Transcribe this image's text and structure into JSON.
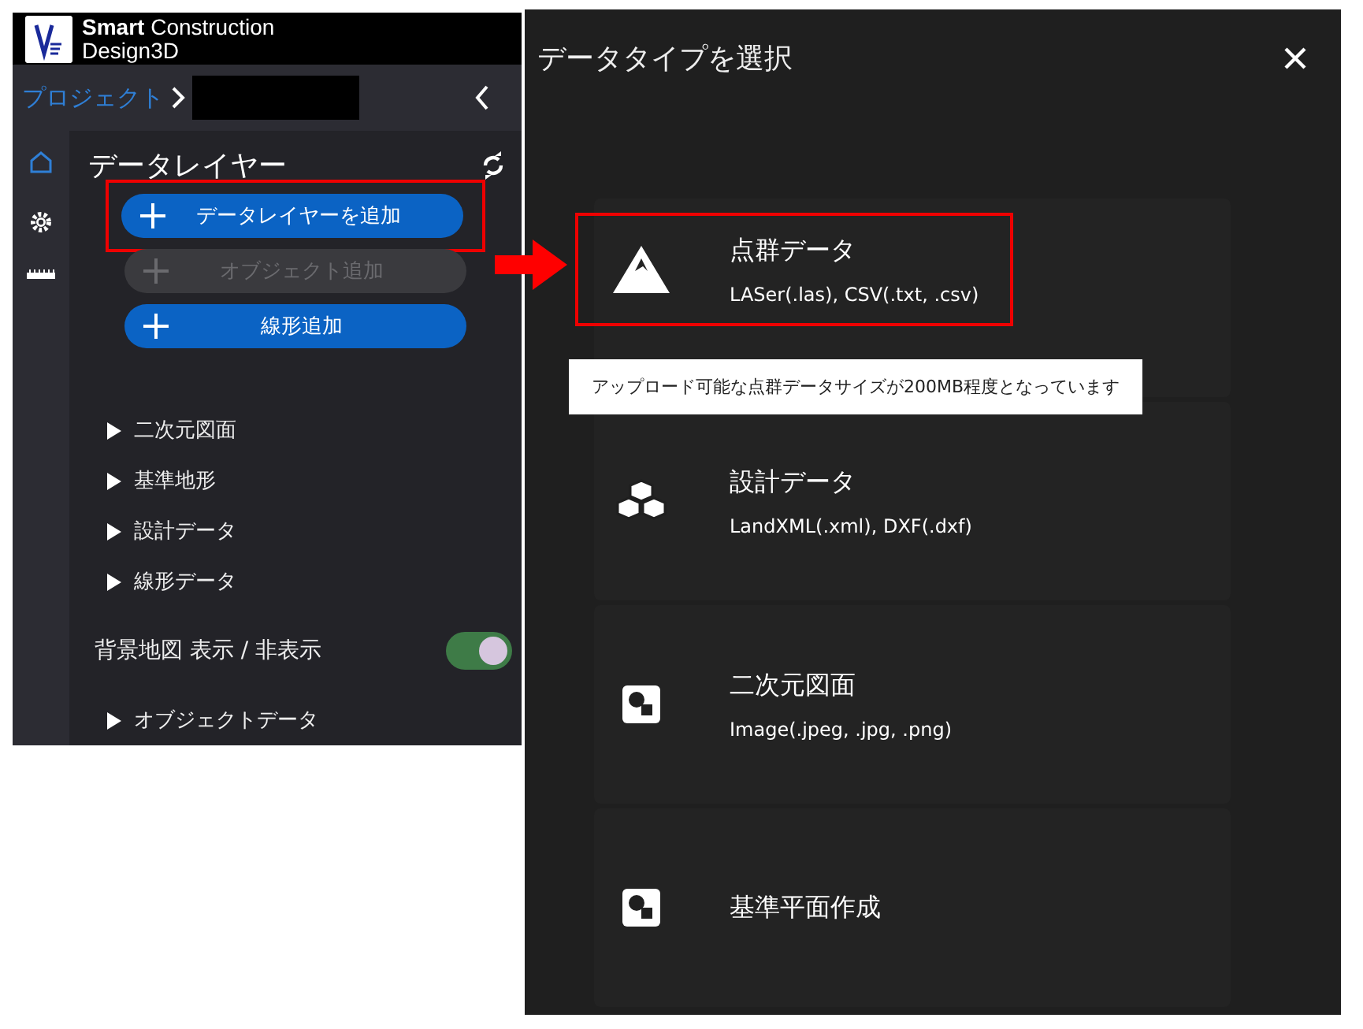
{
  "app": {
    "brand": "**Smart** Construction",
    "brand_line2": "Design3D"
  },
  "breadcrumb": {
    "project": "プロジェクト"
  },
  "side_rail": [
    {
      "kind": "home",
      "selected": true
    },
    {
      "kind": "settings",
      "selected": false
    },
    {
      "kind": "ruler",
      "selected": false
    }
  ],
  "layers_panel": {
    "title": "データレイヤー",
    "buttons": [
      {
        "label": "データレイヤーを追加",
        "disabled": false,
        "highlighted": true
      },
      {
        "label": "オブジェクト追加",
        "disabled": true,
        "highlighted": false
      },
      {
        "label": "線形追加",
        "disabled": false,
        "highlighted": false
      }
    ],
    "items": [
      {
        "kind": "group",
        "label": "二次元図面",
        "expanded": false
      },
      {
        "kind": "group",
        "label": "基準地形",
        "expanded": false
      },
      {
        "kind": "group",
        "label": "設計データ",
        "expanded": false
      },
      {
        "kind": "group",
        "label": "線形データ",
        "expanded": false
      },
      {
        "kind": "toggle",
        "label": "背景地図 表示 / 非表示",
        "on": true
      },
      {
        "kind": "group",
        "label": "オブジェクトデータ",
        "expanded": false
      }
    ]
  },
  "dialog": {
    "title": "データタイプを選択",
    "options": [
      {
        "kind": "mountain",
        "title": "点群データ",
        "formats": "LASer(.las), CSV(.txt, .csv)",
        "highlighted": true
      },
      {
        "kind": "cubes",
        "title": "設計データ",
        "formats": "LandXML(.xml), DXF(.dxf)",
        "highlighted": false
      },
      {
        "kind": "image",
        "title": "二次元図面",
        "formats": "Image(.jpeg, .jpg, .png)",
        "highlighted": false
      },
      {
        "kind": "image",
        "title": "基準平面作成",
        "highlighted": false
      }
    ],
    "tooltip": "アップロード可能な点群データサイズが200MB程度となっています"
  }
}
